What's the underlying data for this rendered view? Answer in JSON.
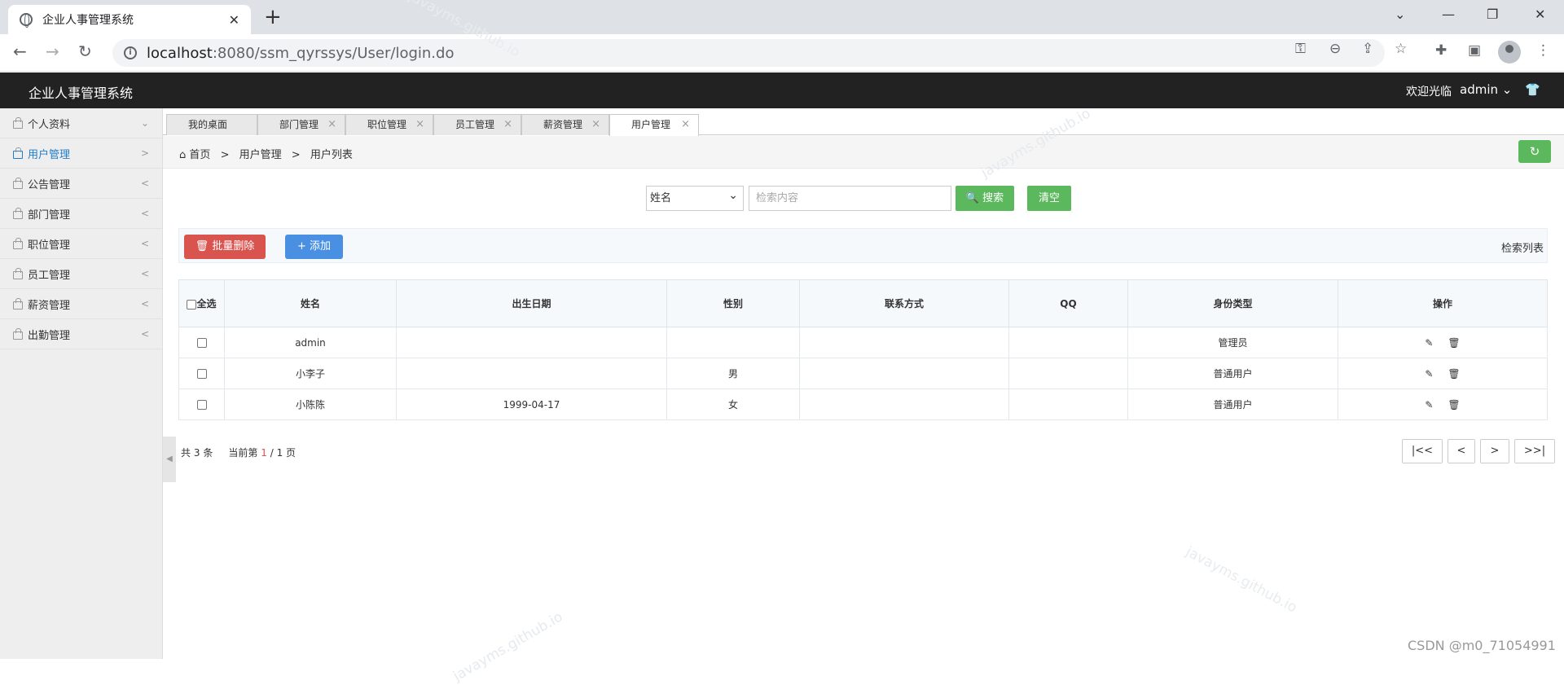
{
  "browser": {
    "tab_title": "企业人事管理系统",
    "url_host": "localhost",
    "url_path": ":8080/ssm_qyrssys/User/login.do"
  },
  "header": {
    "app_title": "企业人事管理系统",
    "welcome": "欢迎光临",
    "username": "admin"
  },
  "sidebar": {
    "items": [
      {
        "label": "个人资料",
        "arrow": "⌄"
      },
      {
        "label": "用户管理",
        "arrow": ">"
      },
      {
        "label": "公告管理",
        "arrow": "<"
      },
      {
        "label": "部门管理",
        "arrow": "<"
      },
      {
        "label": "职位管理",
        "arrow": "<"
      },
      {
        "label": "员工管理",
        "arrow": "<"
      },
      {
        "label": "薪资管理",
        "arrow": "<"
      },
      {
        "label": "出勤管理",
        "arrow": "<"
      }
    ]
  },
  "page_tabs": [
    "我的桌面",
    "部门管理",
    "职位管理",
    "员工管理",
    "薪资管理",
    "用户管理"
  ],
  "breadcrumb": {
    "home": "首页",
    "section": "用户管理",
    "page": "用户列表"
  },
  "search": {
    "field": "姓名",
    "placeholder": "检索内容",
    "search_label": "搜索",
    "clear_label": "清空"
  },
  "toolbar": {
    "batch_delete": "批量删除",
    "add": "添加",
    "list_label": "检索列表"
  },
  "table": {
    "select_all": "全选",
    "columns": [
      "姓名",
      "出生日期",
      "性别",
      "联系方式",
      "QQ",
      "身份类型",
      "操作"
    ],
    "rows": [
      {
        "name": "admin",
        "birth": "",
        "gender": "",
        "contact": "",
        "qq": "",
        "type": "管理员"
      },
      {
        "name": "小李子",
        "birth": "",
        "gender": "男",
        "contact": "",
        "qq": "",
        "type": "普通用户"
      },
      {
        "name": "小陈陈",
        "birth": "1999-04-17",
        "gender": "女",
        "contact": "",
        "qq": "",
        "type": "普通用户"
      }
    ]
  },
  "pagination": {
    "total_prefix": "共",
    "total": "3",
    "total_suffix": "条",
    "current_prefix": "当前第",
    "current": "1",
    "pages": "/ 1",
    "pages_suffix": "页",
    "first": "|<<",
    "prev": "<",
    "next": ">",
    "last": ">>|"
  },
  "watermark": "javayms.github.io",
  "credit": "CSDN @m0_71054991"
}
